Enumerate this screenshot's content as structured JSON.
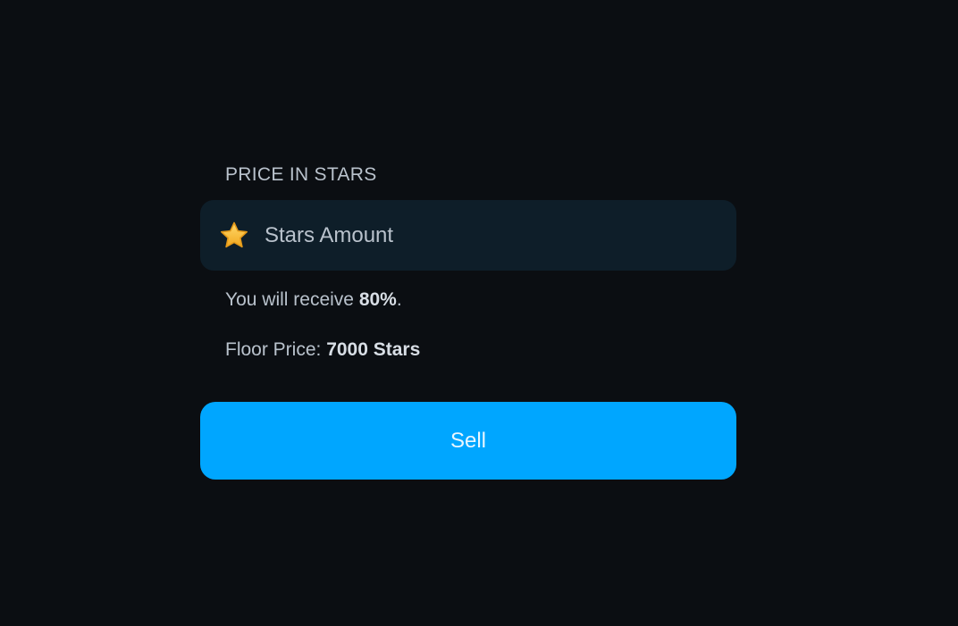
{
  "price_section": {
    "label": "PRICE IN STARS",
    "input": {
      "icon": "star-icon",
      "placeholder": "Stars Amount",
      "value": ""
    }
  },
  "receive": {
    "prefix": "You will receive ",
    "percent": "80%",
    "suffix": "."
  },
  "floor": {
    "prefix": "Floor Price: ",
    "value": "7000 Stars"
  },
  "actions": {
    "sell_label": "Sell"
  },
  "colors": {
    "background": "#0b0e12",
    "input_background": "#0e1e29",
    "accent": "#00a6ff",
    "star": "#f5b82e"
  }
}
